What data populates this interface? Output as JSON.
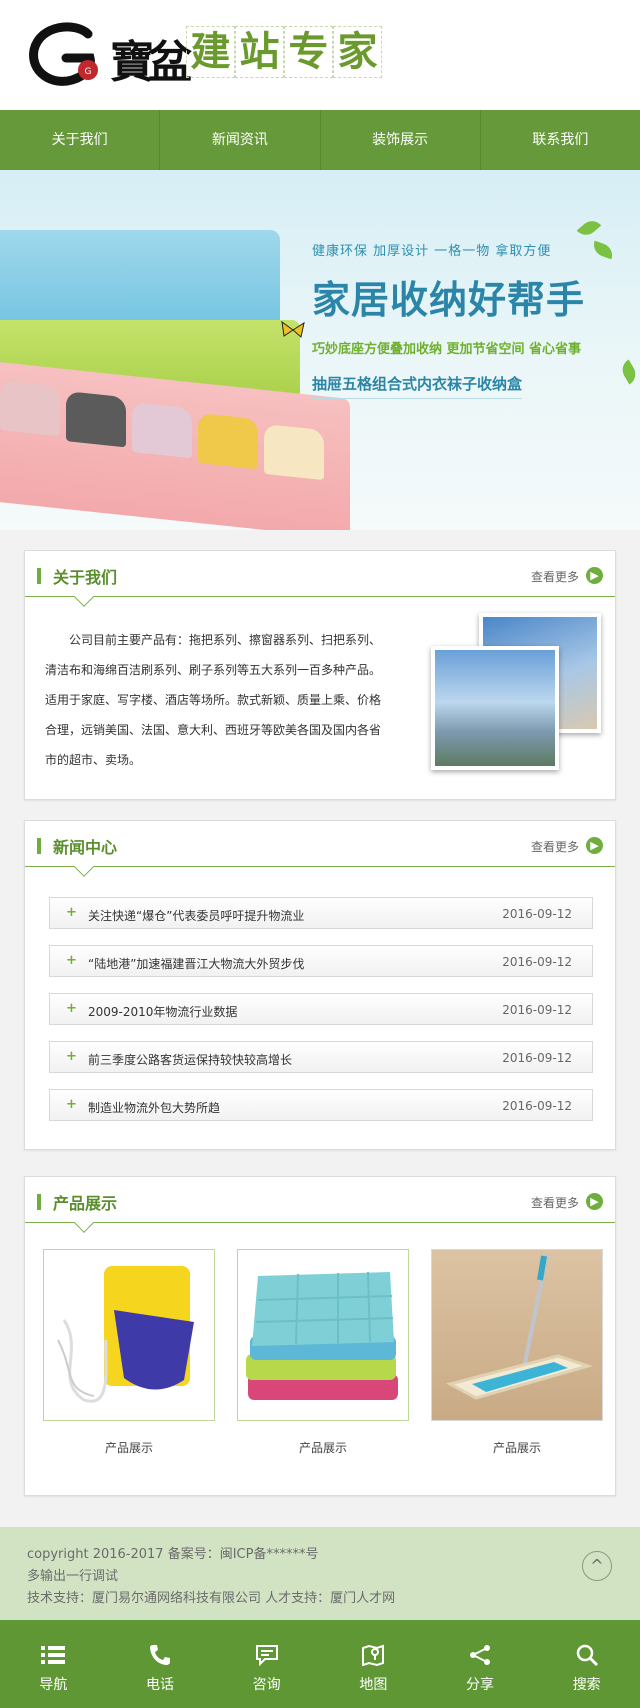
{
  "header": {
    "logo_letter": "G",
    "logo_bao": "寶盆",
    "logo_title": [
      "建",
      "站",
      "专",
      "家"
    ]
  },
  "nav": {
    "items": [
      "关于我们",
      "新闻资讯",
      "装饰展示",
      "联系我们"
    ]
  },
  "banner": {
    "line1": "健康环保   加厚设计   一格一物   拿取方便",
    "headline": "家居收纳好帮手",
    "line3": "巧妙底座方便叠加收纳   更加节省空间   省心省事",
    "line4": "抽屉五格组合式内衣袜子收纳盒"
  },
  "about": {
    "title": "关于我们",
    "more": "查看更多",
    "text": "公司目前主要产品有：拖把系列、擦窗器系列、扫把系列、清洁布和海绵百洁刷系列、刷子系列等五大系列一百多种产品。适用于家庭、写字楼、酒店等场所。款式新颖、质量上乘、价格合理，远销美国、法国、意大利、西班牙等欧美各国及国内各省市的超市、卖场。"
  },
  "news": {
    "title": "新闻中心",
    "more": "查看更多",
    "items": [
      {
        "title": "关注快递“爆仓”代表委员呼吁提升物流业",
        "date": "2016-09-12"
      },
      {
        "title": "“陆地港”加速福建晋江大物流大外贸步伐",
        "date": "2016-09-12"
      },
      {
        "title": "2009-2010年物流行业数据",
        "date": "2016-09-12"
      },
      {
        "title": "前三季度公路客货运保持较快较高增长",
        "date": "2016-09-12"
      },
      {
        "title": "制造业物流外包大势所趋",
        "date": "2016-09-12"
      }
    ]
  },
  "products": {
    "title": "产品展示",
    "more": "查看更多",
    "items": [
      {
        "label": "产品展示"
      },
      {
        "label": "产品展示"
      },
      {
        "label": "产品展示"
      }
    ]
  },
  "footer": {
    "copyright": "copyright 2016-2017 备案号：闽ICP备******号",
    "line2": "多输出一行调试",
    "support": "技术支持：厦门易尔通网络科技有限公司 人才支持：厦门人才网",
    "top_icon": "^"
  },
  "bottom_bar": {
    "items": [
      {
        "label": "导航",
        "icon": "menu-icon"
      },
      {
        "label": "电话",
        "icon": "phone-icon"
      },
      {
        "label": "咨询",
        "icon": "chat-icon"
      },
      {
        "label": "地图",
        "icon": "map-icon"
      },
      {
        "label": "分享",
        "icon": "share-icon"
      },
      {
        "label": "搜索",
        "icon": "search-icon"
      }
    ]
  },
  "colors": {
    "brand_green": "#66993a",
    "footer_bg": "#d2e3c4",
    "banner_blue": "#2b85a8"
  }
}
